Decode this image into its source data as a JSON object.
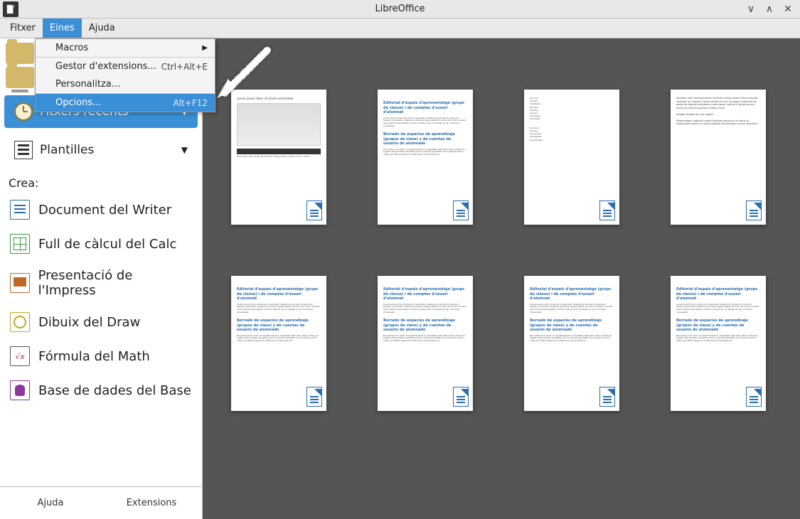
{
  "titlebar": {
    "title": "LibreOffice"
  },
  "menubar": {
    "items": [
      "Fitxer",
      "Eines",
      "Ajuda"
    ],
    "active_index": 1
  },
  "dropdown": {
    "items": [
      {
        "label": "Macros",
        "shortcut": "",
        "submenu": true
      },
      {
        "label": "Gestor d'extensions...",
        "shortcut": "Ctrl+Alt+E"
      },
      {
        "label": "Personalitza...",
        "shortcut": ""
      },
      {
        "label": "Opcions...",
        "shortcut": "Alt+F12",
        "highlighted": true
      }
    ]
  },
  "sidebar": {
    "recent": "Fitxers recents",
    "templates": "Plantilles",
    "create_label": "Crea:",
    "create": [
      {
        "label": "Document del Writer",
        "kind": "writer"
      },
      {
        "label": "Full de càlcul del Calc",
        "kind": "calc"
      },
      {
        "label": "Presentació de l'Impress",
        "kind": "impress"
      },
      {
        "label": "Dibuix del Draw",
        "kind": "draw"
      },
      {
        "label": "Fórmula del Math",
        "kind": "math"
      },
      {
        "label": "Base de dades del Base",
        "kind": "base"
      }
    ],
    "bottom": {
      "help": "Ajuda",
      "extensions": "Extensions"
    }
  },
  "thumbnails": {
    "count": 8
  }
}
